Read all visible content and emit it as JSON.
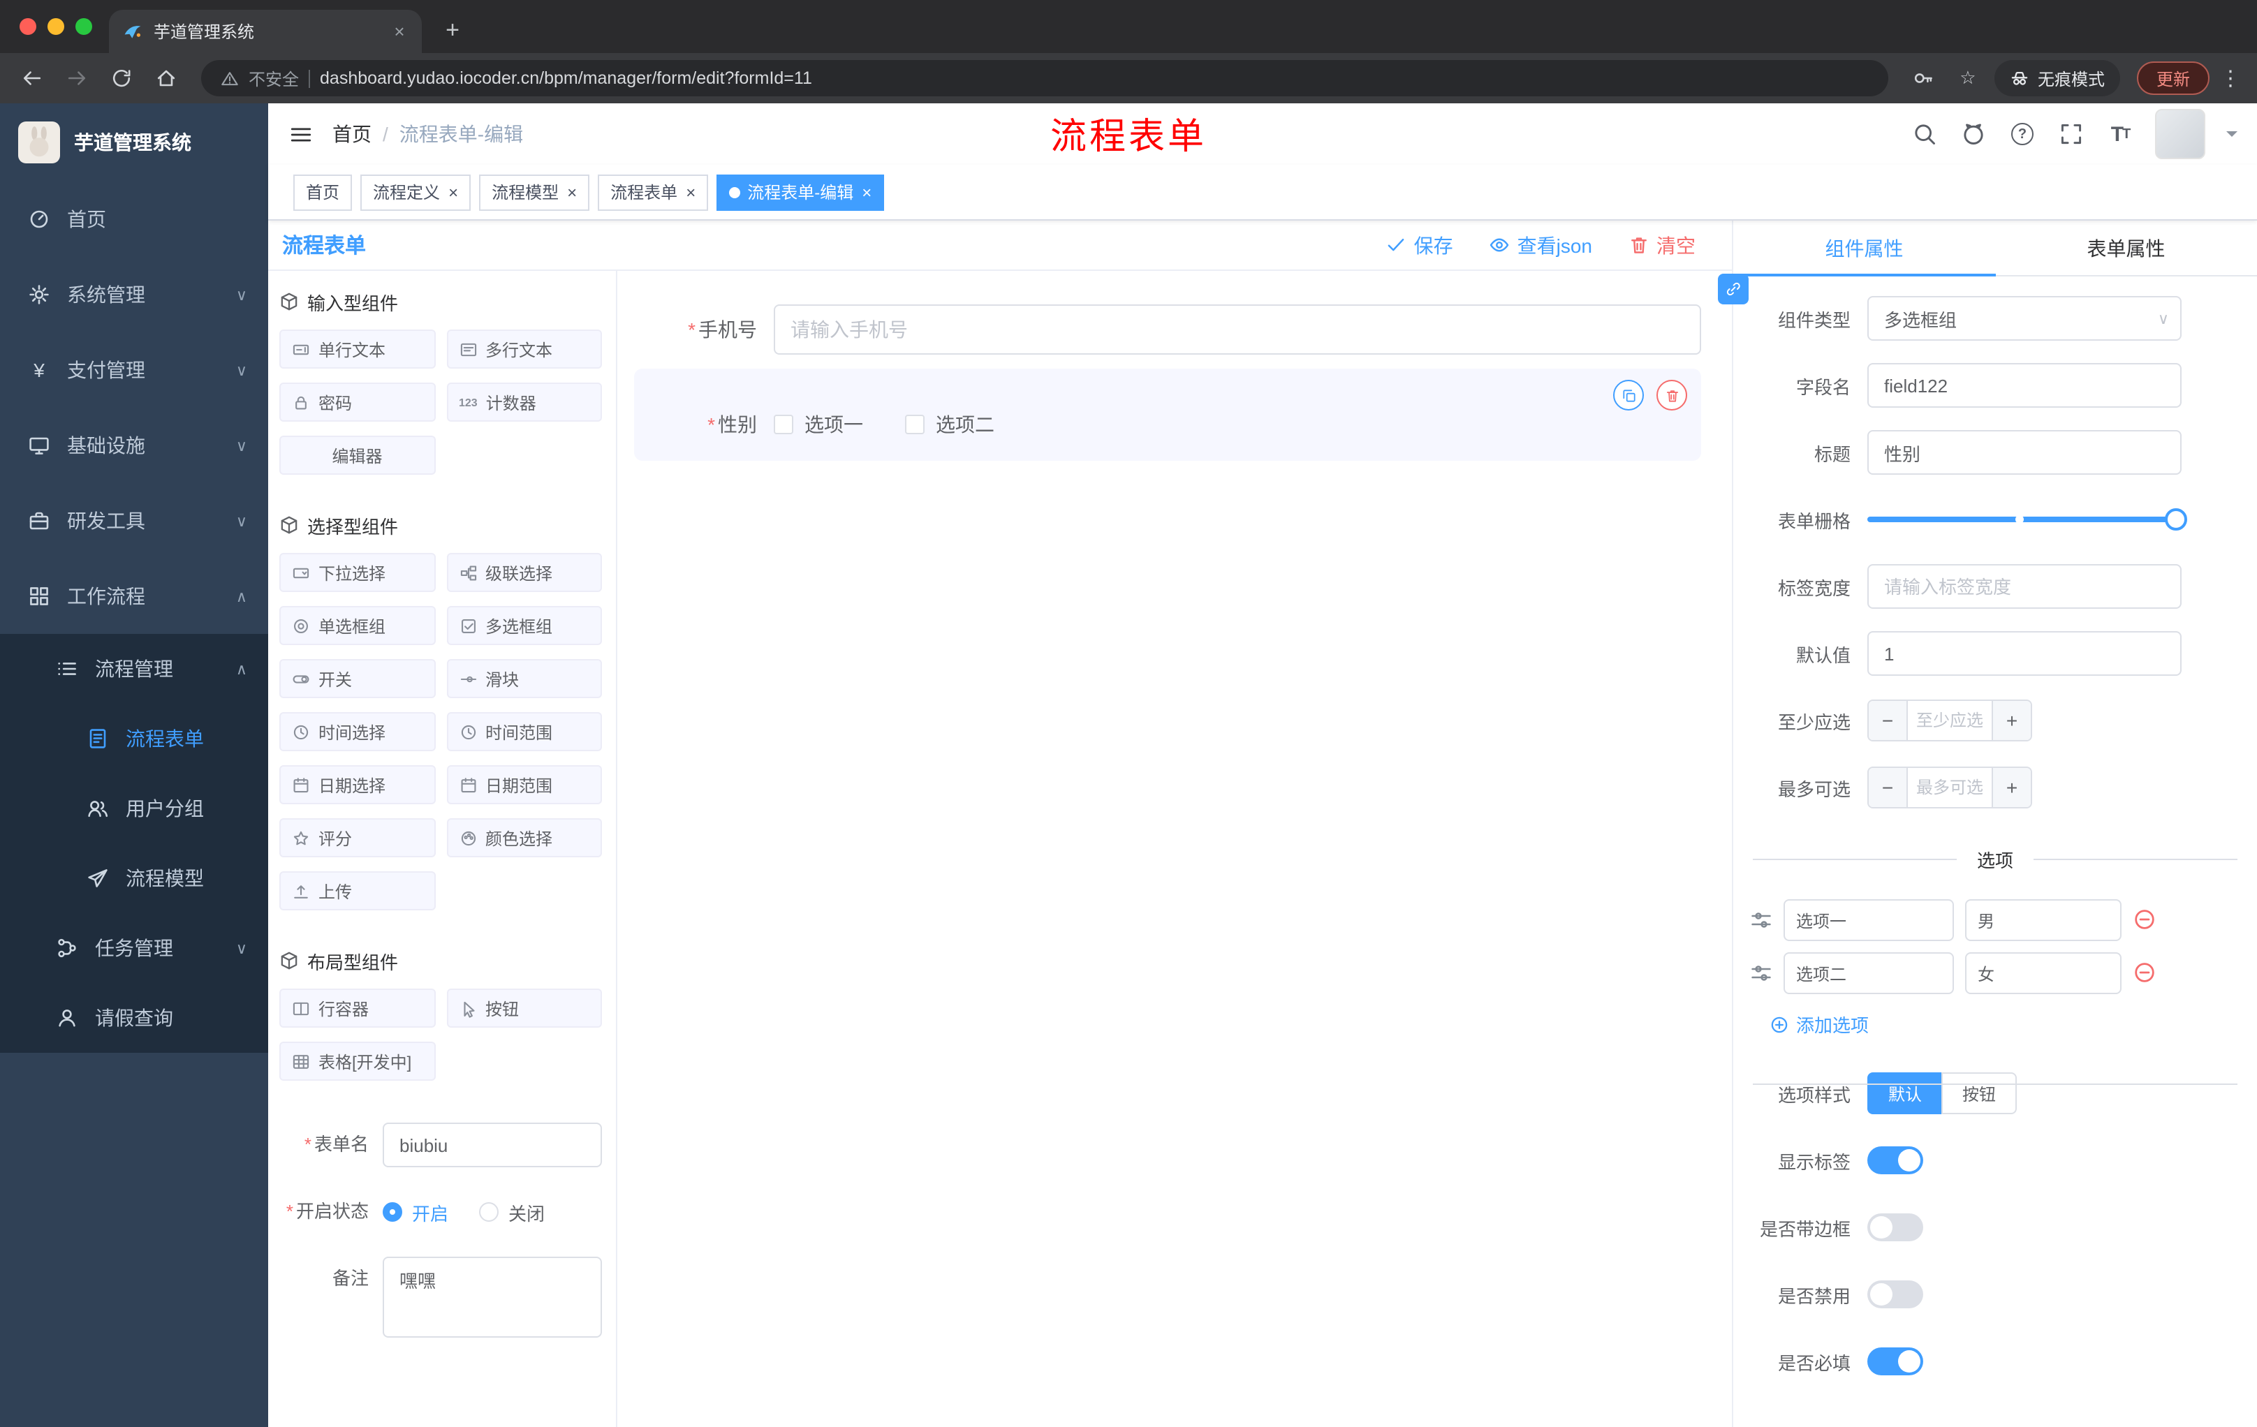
{
  "browser": {
    "tab_title": "芋道管理系统",
    "security": "不安全",
    "url": "dashboard.yudao.iocoder.cn/bpm/manager/form/edit?formId=11",
    "incognito": "无痕模式",
    "update": "更新"
  },
  "sidebar": {
    "brand": "芋道管理系统",
    "items": [
      {
        "label": "首页"
      },
      {
        "label": "系统管理"
      },
      {
        "label": "支付管理"
      },
      {
        "label": "基础设施"
      },
      {
        "label": "研发工具"
      },
      {
        "label": "工作流程"
      },
      {
        "label": "流程管理"
      },
      {
        "label": "流程表单"
      },
      {
        "label": "用户分组"
      },
      {
        "label": "流程模型"
      },
      {
        "label": "任务管理"
      },
      {
        "label": "请假查询"
      }
    ]
  },
  "header": {
    "breadcrumb_home": "首页",
    "breadcrumb_current": "流程表单-编辑",
    "banner": "流程表单"
  },
  "tags": [
    {
      "label": "首页"
    },
    {
      "label": "流程定义"
    },
    {
      "label": "流程模型"
    },
    {
      "label": "流程表单"
    },
    {
      "label": "流程表单-编辑"
    }
  ],
  "designer": {
    "title": "流程表单",
    "save": "保存",
    "view_json": "查看json",
    "clear": "清空",
    "sections": [
      {
        "title": "输入型组件"
      },
      {
        "title": "选择型组件"
      },
      {
        "title": "布局型组件"
      }
    ],
    "palette": {
      "input": [
        "单行文本",
        "多行文本",
        "密码",
        "计数器",
        "编辑器"
      ],
      "select": [
        "下拉选择",
        "级联选择",
        "单选框组",
        "多选框组",
        "开关",
        "滑块",
        "时间选择",
        "时间范围",
        "日期选择",
        "日期范围",
        "评分",
        "颜色选择",
        "上传"
      ],
      "layout": [
        "行容器",
        "按钮",
        "表格[开发中]"
      ]
    },
    "form": {
      "name_label": "表单名",
      "name_value": "biubiu",
      "status_label": "开启状态",
      "status_on": "开启",
      "status_off": "关闭",
      "remark_label": "备注",
      "remark_value": "嘿嘿"
    },
    "canvas": {
      "phone_label": "手机号",
      "phone_placeholder": "请输入手机号",
      "gender_label": "性别",
      "gender_opt1": "选项一",
      "gender_opt2": "选项二"
    }
  },
  "props": {
    "tab_component": "组件属性",
    "tab_form": "表单属性",
    "type_label": "组件类型",
    "type_value": "多选框组",
    "field_label": "字段名",
    "field_value": "field122",
    "title_label": "标题",
    "title_value": "性别",
    "grid_label": "表单栅格",
    "width_label": "标签宽度",
    "width_placeholder": "请输入标签宽度",
    "default_label": "默认值",
    "default_value": "1",
    "min_label": "至少应选",
    "min_placeholder": "至少应选",
    "max_label": "最多可选",
    "max_placeholder": "最多可选",
    "options_title": "选项",
    "options": [
      {
        "name": "选项一",
        "value": "男"
      },
      {
        "name": "选项二",
        "value": "女"
      }
    ],
    "add_option": "添加选项",
    "style_label": "选项样式",
    "style_default": "默认",
    "style_button": "按钮",
    "switches": [
      {
        "label": "显示标签"
      },
      {
        "label": "是否带边框"
      },
      {
        "label": "是否禁用"
      },
      {
        "label": "是否必填"
      }
    ],
    "colors": {
      "accent": "#409eff",
      "danger": "#f56c6c",
      "banner": "#ff0000"
    }
  }
}
